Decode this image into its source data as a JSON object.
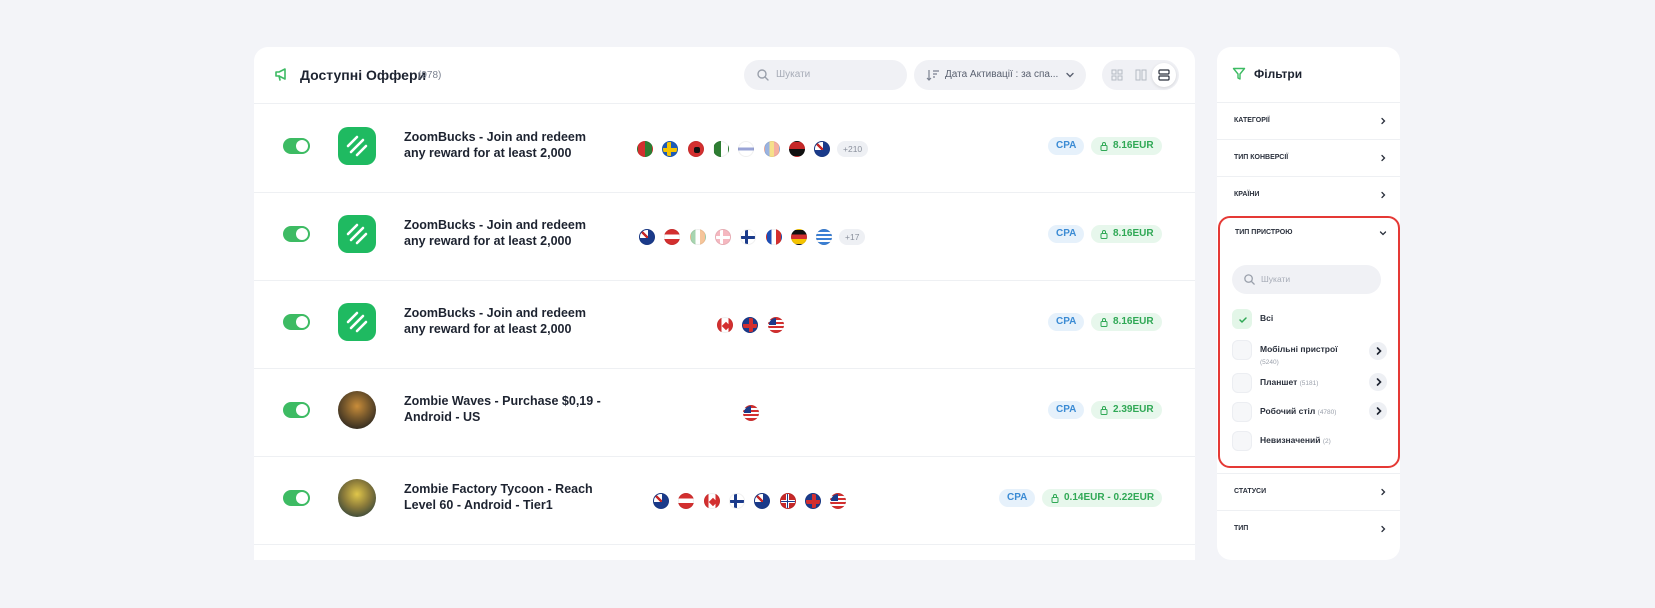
{
  "header": {
    "title": "Доступні Оффери",
    "count": "(978)",
    "search_placeholder": "Шукати",
    "sort_label": "Дата Активації : за спа..."
  },
  "offers": [
    {
      "name": "ZoomBucks - Join and redeem any reward for at least 2,000",
      "more": "+210",
      "type": "CPA",
      "payout": "8.16EUR"
    },
    {
      "name": "ZoomBucks - Join and redeem any reward for at least 2,000",
      "more": "+17",
      "type": "CPA",
      "payout": "8.16EUR"
    },
    {
      "name": "ZoomBucks - Join and redeem any reward for at least 2,000",
      "type": "CPA",
      "payout": "8.16EUR"
    },
    {
      "name": "Zombie Waves - Purchase $0,19 - Android - US",
      "type": "CPA",
      "payout": "2.39EUR"
    },
    {
      "name": "Zombie Factory Tycoon - Reach Level 60 - Android - Tier1",
      "type": "CPA",
      "payout": "0.14EUR - 0.22EUR"
    }
  ],
  "filters": {
    "title": "Фільтри",
    "sections": [
      "Категорії",
      "Тип конверсії",
      "Країни",
      "Тип пристрою",
      "Статуси",
      "Тип"
    ],
    "device": {
      "search_placeholder": "Шукати",
      "options": [
        {
          "label": "Всі",
          "count": "",
          "checked": true
        },
        {
          "label": "Мобільні пристрої",
          "count": "(5240)",
          "checked": false
        },
        {
          "label": "Планшет",
          "count": "(5181)",
          "checked": false
        },
        {
          "label": "Робочий стіл",
          "count": "(4780)",
          "checked": false
        },
        {
          "label": "Невизначений",
          "count": "(2)",
          "checked": false
        }
      ]
    }
  },
  "colors": {
    "accent_green": "#3dbb63",
    "highlight_red": "#e53935",
    "cpa_blue": "#3b8bd4"
  }
}
